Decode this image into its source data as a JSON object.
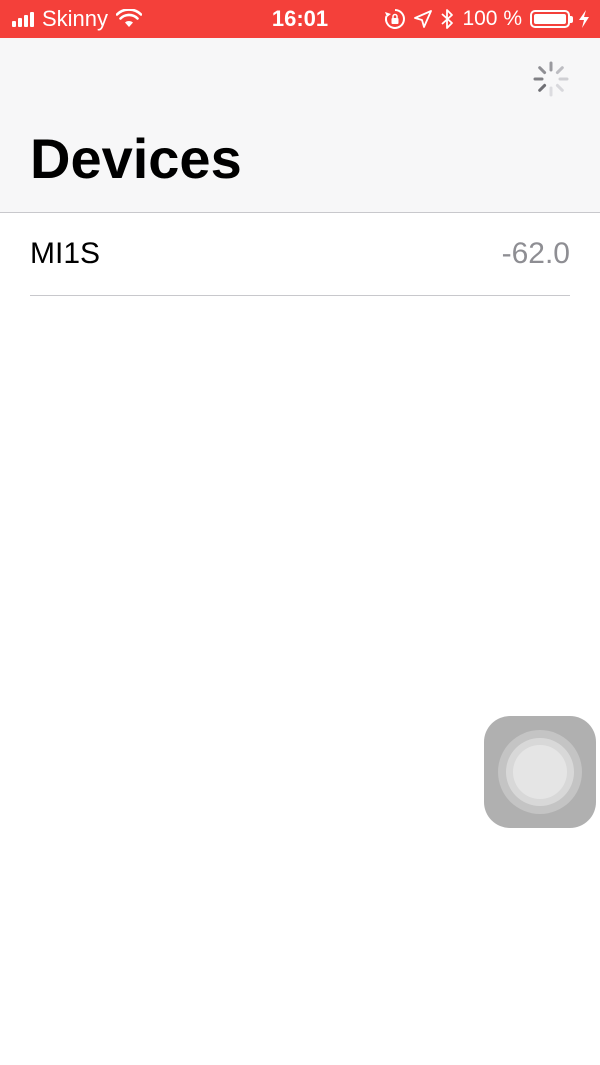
{
  "status_bar": {
    "carrier": "Skinny",
    "time": "16:01",
    "battery_percent": "100 %",
    "icons": [
      "signal-icon",
      "wifi-icon",
      "rotation-lock-icon",
      "location-icon",
      "bluetooth-icon",
      "battery-icon",
      "charging-icon"
    ],
    "background_color": "#f4403a"
  },
  "nav": {
    "title": "Devices",
    "activity_indicator": "spinner-icon"
  },
  "devices": [
    {
      "name": "MI1S",
      "value": "-62.0"
    }
  ],
  "assistive_touch": {
    "icon": "assistive-touch-icon"
  }
}
